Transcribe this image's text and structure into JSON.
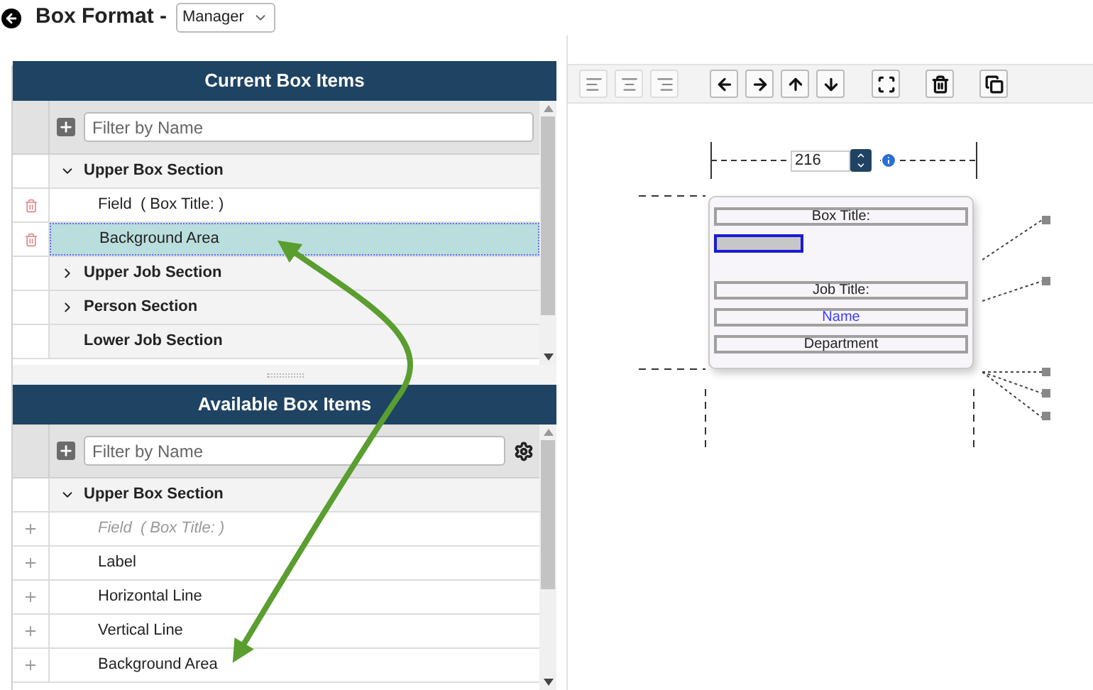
{
  "header": {
    "title": "Box Format -",
    "role_select": {
      "value": "Manager"
    }
  },
  "current_items": {
    "title": "Current Box Items",
    "filter": {
      "placeholder": "Filter by Name"
    },
    "rows": [
      {
        "kind": "section",
        "label": "Upper Box Section",
        "expanded": true
      },
      {
        "kind": "item",
        "label": "Field  ( Box Title: )",
        "selected": false
      },
      {
        "kind": "item",
        "label": "Background Area",
        "selected": true
      },
      {
        "kind": "section",
        "label": "Upper Job Section",
        "expanded": false
      },
      {
        "kind": "section",
        "label": "Person Section",
        "expanded": false
      },
      {
        "kind": "plain_section",
        "label": "Lower Job Section"
      }
    ]
  },
  "available_items": {
    "title": "Available Box Items",
    "filter": {
      "placeholder": "Filter by Name"
    },
    "rows": [
      {
        "kind": "section",
        "label": "Upper Box Section",
        "expanded": true
      },
      {
        "kind": "item",
        "label": "Field  ( Box Title: )",
        "disabled": true
      },
      {
        "kind": "item",
        "label": "Label",
        "disabled": false
      },
      {
        "kind": "item",
        "label": "Horizontal Line",
        "disabled": false
      },
      {
        "kind": "item",
        "label": "Vertical Line",
        "disabled": false
      },
      {
        "kind": "item",
        "label": "Background Area",
        "disabled": false
      }
    ]
  },
  "toolbar": [
    {
      "kind": "align-left",
      "disabled": true
    },
    {
      "kind": "align-center",
      "disabled": true
    },
    {
      "kind": "align-right",
      "disabled": true
    },
    {
      "kind": "arrow-left",
      "disabled": false
    },
    {
      "kind": "arrow-right",
      "disabled": false
    },
    {
      "kind": "arrow-up",
      "disabled": false
    },
    {
      "kind": "arrow-down",
      "disabled": false
    },
    {
      "kind": "fit",
      "disabled": false
    },
    {
      "kind": "delete",
      "disabled": false
    },
    {
      "kind": "copy",
      "disabled": false
    }
  ],
  "canvas": {
    "width_field": {
      "value": "216"
    },
    "elements": [
      {
        "kind": "label",
        "text": "Box Title:"
      },
      {
        "kind": "background",
        "selected": true
      },
      {
        "kind": "label",
        "text": "Job Title:"
      },
      {
        "kind": "field",
        "text": "Name"
      },
      {
        "kind": "label",
        "text": "Department"
      }
    ]
  }
}
